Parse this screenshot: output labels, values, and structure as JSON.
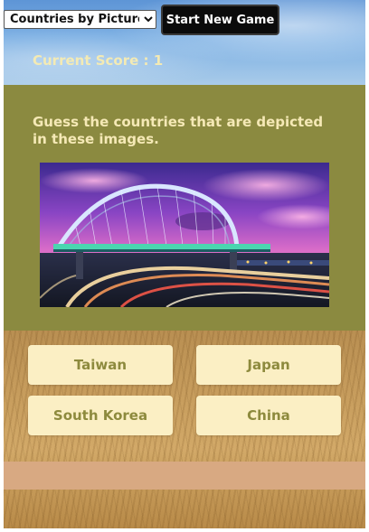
{
  "header": {
    "mode_select": {
      "selected": "Countries by Pictures",
      "options": [
        "Countries by Pictures"
      ]
    },
    "start_button_label": "Start New Game",
    "score_text": "Current Score : 1"
  },
  "question": {
    "prompt": "Guess the countries that are depicted in these images.",
    "image_icon": "bridge-photo"
  },
  "answers": [
    {
      "label": "Taiwan"
    },
    {
      "label": "Japan"
    },
    {
      "label": "South Korea"
    },
    {
      "label": "China"
    }
  ],
  "feedback": {
    "text": ""
  },
  "colors": {
    "question_bg": "#8b8a40",
    "answer_bg": "#fbefc4",
    "answer_text": "#8d8a3d",
    "score_text": "#f3eab4",
    "feedback_bar": "#d8a982"
  }
}
